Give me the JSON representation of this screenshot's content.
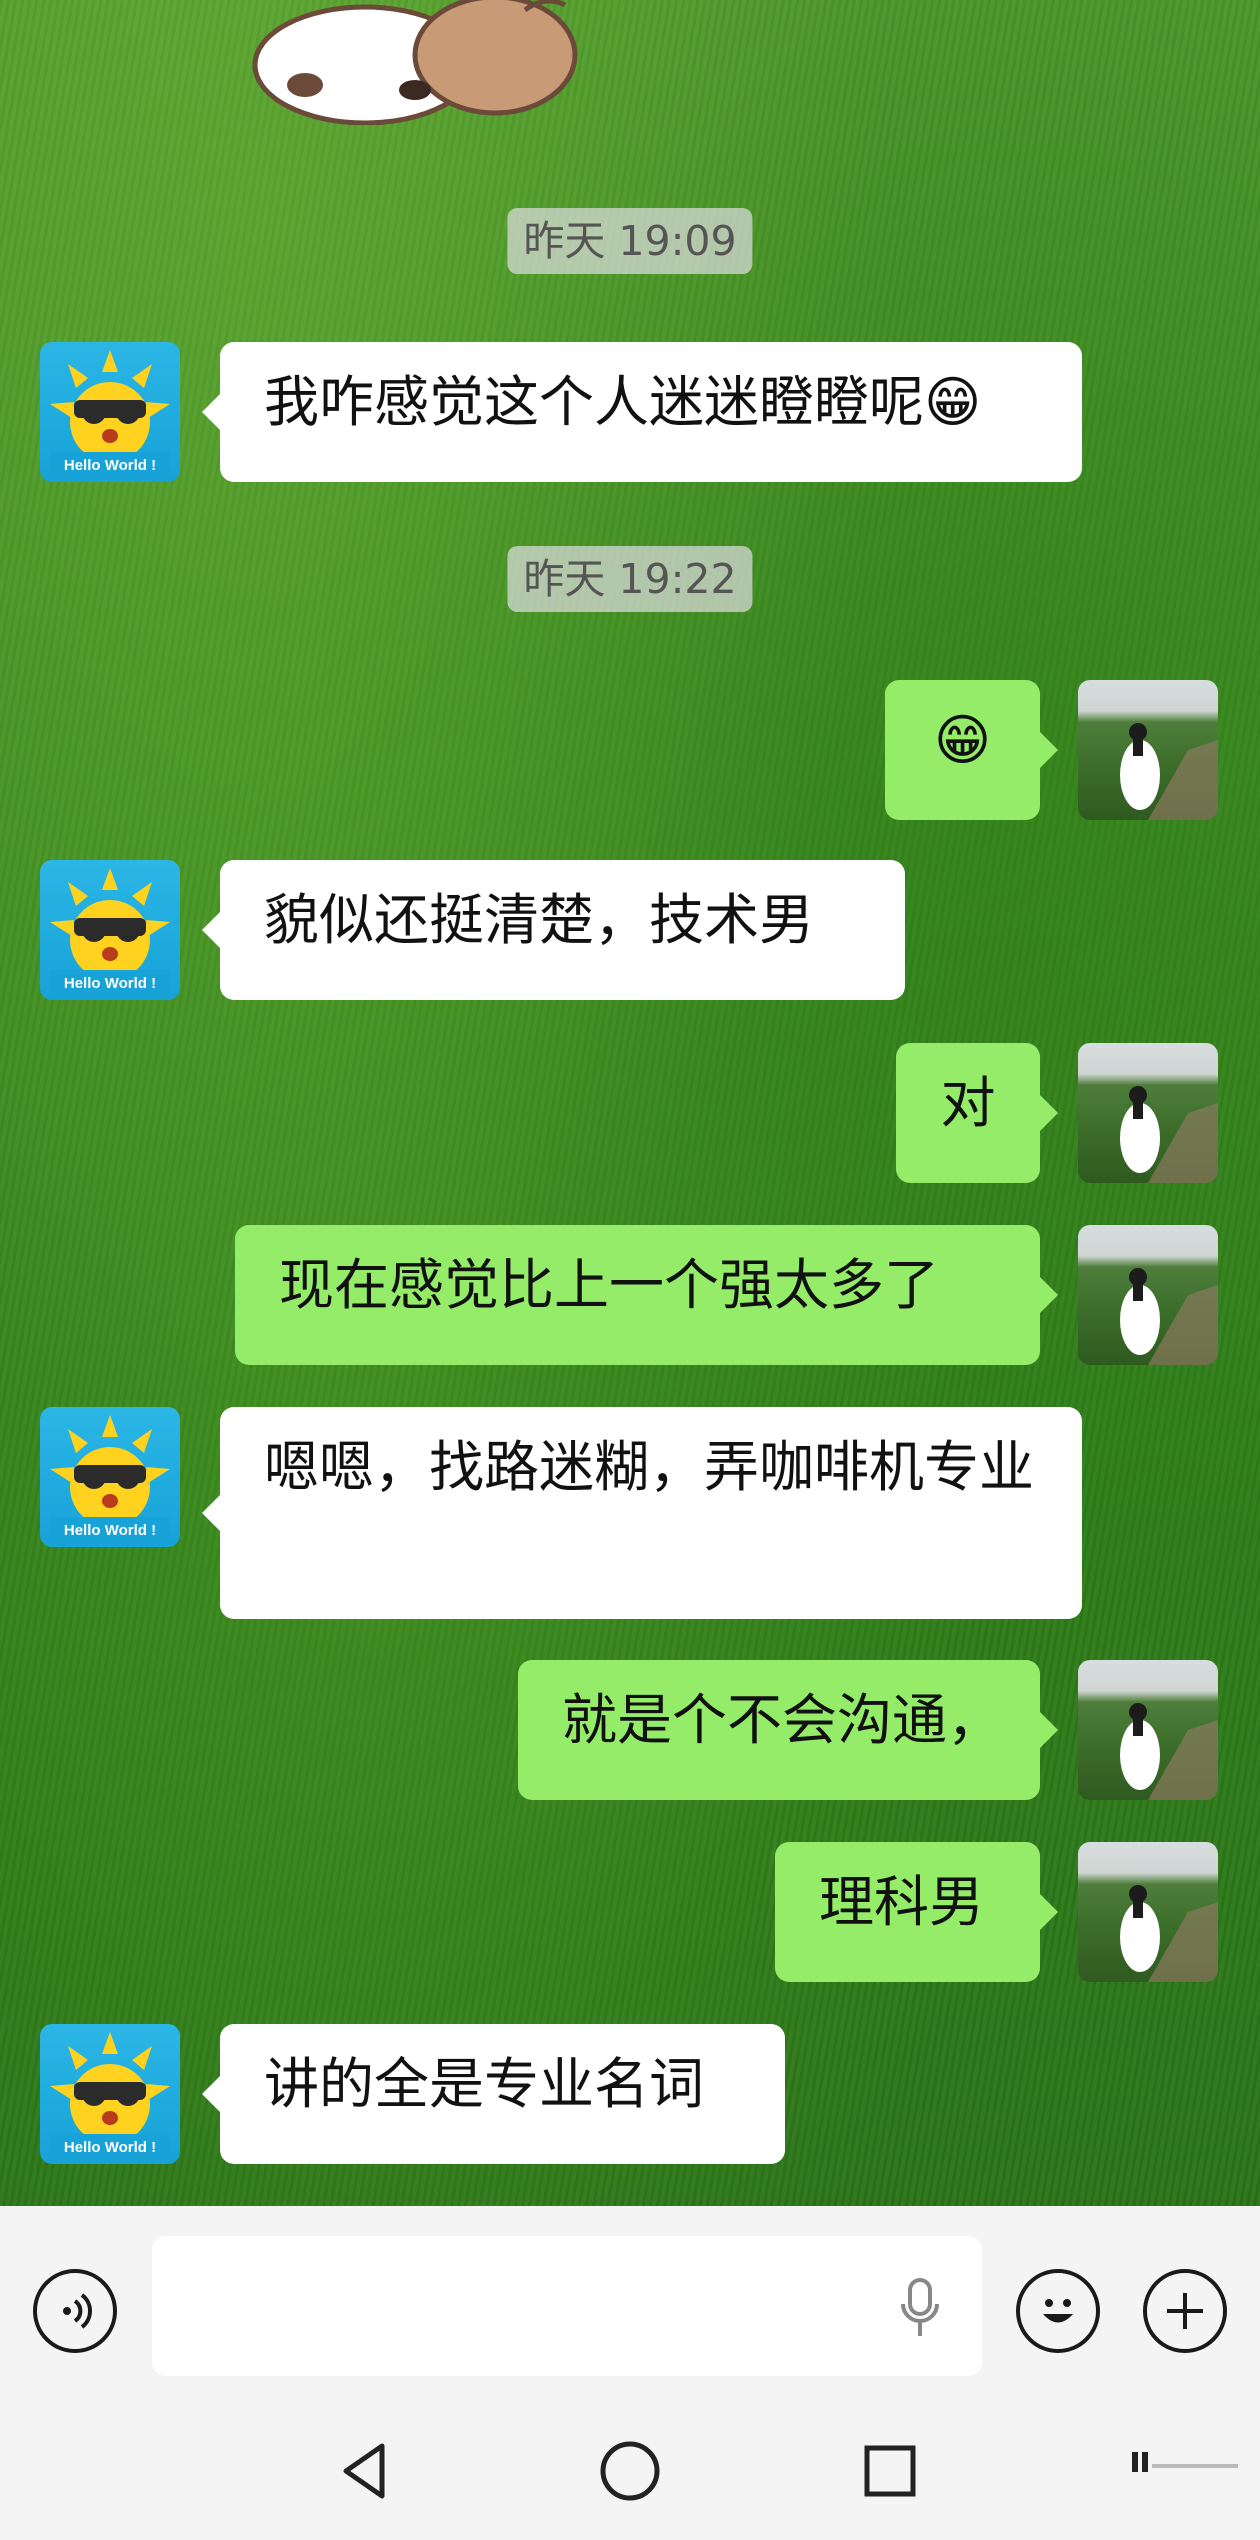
{
  "timestamps": [
    "昨天 19:09",
    "昨天 19:22"
  ],
  "contacts": {
    "left_avatar_text": "Hello World !"
  },
  "messages": [
    {
      "side": "in",
      "text": "我咋感觉这个人迷迷瞪瞪呢😁"
    },
    {
      "side": "out",
      "text": "😁"
    },
    {
      "side": "in",
      "text": "貌似还挺清楚，技术男"
    },
    {
      "side": "out",
      "text": "对"
    },
    {
      "side": "out",
      "text": "现在感觉比上一个强太多了"
    },
    {
      "side": "in",
      "text": "嗯嗯，找路迷糊，弄咖啡机专业"
    },
    {
      "side": "out",
      "text": "就是个不会沟通，"
    },
    {
      "side": "out",
      "text": "理科男"
    },
    {
      "side": "in",
      "text": "讲的全是专业名词"
    }
  ],
  "input_bar": {
    "text_value": "",
    "icons": [
      "voice-icon",
      "microphone-icon",
      "emoji-icon",
      "plus-icon"
    ]
  },
  "nav_bar": {
    "icons": [
      "back-icon",
      "home-icon",
      "recents-icon"
    ]
  },
  "colors": {
    "incoming_bubble": "#ffffff",
    "outgoing_bubble": "#95ec69",
    "bar_background": "#f4f4f4"
  }
}
